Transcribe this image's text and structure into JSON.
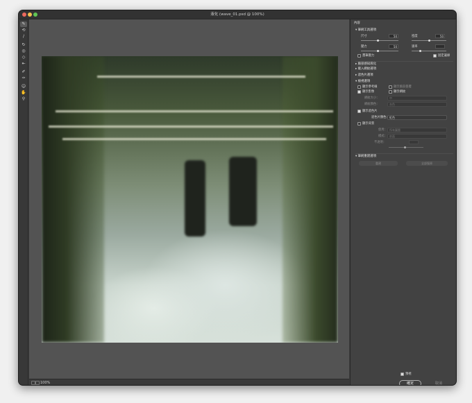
{
  "window": {
    "title": "液化 (wave_01.psd @ 100%)"
  },
  "toolbar": {
    "tools": [
      "向前變形工具",
      "重建工具",
      "平滑工具",
      "順時針扭轉工具",
      "縮攏工具",
      "膨脹工具",
      "左推工具",
      "凍結遮色片工具",
      "解凍遮色片工具",
      "臉部工具",
      "手形工具",
      "縮放顯示工具"
    ]
  },
  "status": {
    "zoom": "100%"
  },
  "panel": {
    "header": "內容",
    "brush_tool_options": {
      "title": "筆刷工具選項",
      "size_label": "尺寸",
      "size_value": "50",
      "density_label": "密度",
      "density_value": "50",
      "pressure_label": "壓力",
      "pressure_value": "50",
      "rate_label": "速率",
      "rate_value": "",
      "stylus_pressure_label": "畫筆壓力",
      "pin_edges_label": "固定邊緣"
    },
    "face_aware": {
      "title": "臉部感知液化"
    },
    "load_mesh": {
      "title": "載入網紋選項"
    },
    "mask_options": {
      "title": "遮色片選項"
    },
    "view_options": {
      "title": "檢視選項",
      "show_guides_label": "顯示參考線",
      "show_face_overlay_label": "顯示臉部疊覆",
      "show_image_label": "顯示影像",
      "show_mesh_label": "顯示網紋",
      "mesh_size_label": "網紋大小：",
      "mesh_size_value": "中",
      "mesh_color_label": "網紋顏色：",
      "mesh_color_value": "灰色",
      "show_mask_label": "顯示遮色片",
      "mask_color_label": "遮色片顏色：",
      "mask_color_value": "紅色",
      "show_backdrop_label": "顯示背景",
      "use_label": "使用：",
      "use_value": "所有圖層",
      "mode_label": "模式：",
      "mode_value": "前面",
      "opacity_label": "不透明："
    },
    "brush_reconstruct": {
      "title": "筆刷重建選項",
      "reconstruct_button": "重建",
      "restore_all_button": "全部復原"
    },
    "preview_label": "預視",
    "ok_button": "確定",
    "cancel_button": "取消"
  }
}
